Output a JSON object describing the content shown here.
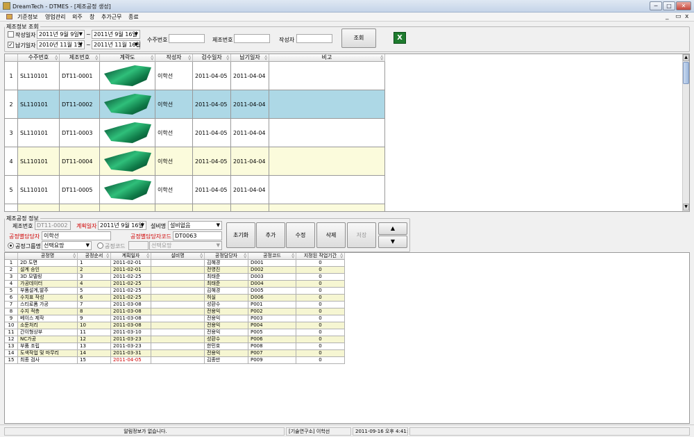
{
  "window": {
    "title": "DreamTech - DTMES - [제조공정 생성]",
    "buttons": [
      "─",
      "□",
      "✕"
    ],
    "mdi_buttons": [
      "_",
      "▭",
      "x"
    ]
  },
  "menu": [
    "기준정보",
    "영업관리",
    "외주",
    "창",
    "추가근무",
    "종료"
  ],
  "search": {
    "group_label": "제조정보 조회",
    "write_date": {
      "label": "작성일자",
      "checked": false,
      "from": "2011년  9월  9일",
      "to": "2011년  9월 16일",
      "sep": "~"
    },
    "due_date": {
      "label": "납기일자",
      "checked": true,
      "from": "2010년 11월  1일",
      "to": "2011년 11월 16일",
      "sep": "~"
    },
    "order_no": {
      "label": "수주번호",
      "value": ""
    },
    "mfg_no": {
      "label": "제조번호",
      "value": ""
    },
    "writer": {
      "label": "작성자",
      "value": ""
    },
    "search_button": "조회",
    "excel_icon": "excel-icon"
  },
  "grid1": {
    "columns": [
      "수주번호",
      "제조번호",
      "계략도",
      "작성자",
      "검수일자",
      "납기일자",
      "비고"
    ],
    "rows": [
      {
        "num": "1",
        "order": "SL110101",
        "mfg": "DT11-0001",
        "writer": "이학선",
        "check": "2011-04-05",
        "due": "2011-04-04",
        "note": ""
      },
      {
        "num": "2",
        "order": "SL110101",
        "mfg": "DT11-0002",
        "writer": "이학선",
        "check": "2011-04-05",
        "due": "2011-04-04",
        "note": ""
      },
      {
        "num": "3",
        "order": "SL110101",
        "mfg": "DT11-0003",
        "writer": "이학선",
        "check": "2011-04-05",
        "due": "2011-04-04",
        "note": ""
      },
      {
        "num": "4",
        "order": "SL110101",
        "mfg": "DT11-0004",
        "writer": "이학선",
        "check": "2011-04-05",
        "due": "2011-04-04",
        "note": ""
      },
      {
        "num": "5",
        "order": "SL110101",
        "mfg": "DT11-0005",
        "writer": "이학선",
        "check": "2011-04-05",
        "due": "2011-04-04",
        "note": ""
      }
    ]
  },
  "process_info": {
    "group_label": "제조공정 정보",
    "mfg_no": {
      "label": "제조번호",
      "value": "DT11-0002"
    },
    "plan_date": {
      "label": "계획일자",
      "value": "2011년  9월 16일"
    },
    "equipment": {
      "label": "설비명",
      "value": "설비없음"
    },
    "manager": {
      "label": "공정별담당자",
      "value": "이학선"
    },
    "manager_code": {
      "label": "공정별담당자코드",
      "value": "DT0063"
    },
    "group_name": {
      "label": "공정그룹명",
      "value": "선택요망",
      "selected": true
    },
    "process_code": {
      "label": "공정코드",
      "value": "",
      "select": "선택요망",
      "selected": false
    },
    "buttons": {
      "reset": "초기화",
      "add": "추가",
      "edit": "수정",
      "delete": "삭제",
      "save": "저장",
      "up": "▲",
      "down": "▼"
    }
  },
  "grid2": {
    "columns": [
      "공정명",
      "공정순서",
      "계획일자",
      "설비명",
      "공정담당자",
      "공정코드",
      "지정된 작업기간"
    ],
    "rows": [
      {
        "num": "1",
        "name": "2D 도면",
        "seq": "1",
        "plan": "2011-02-01",
        "equip": "",
        "mgr": "김혜경",
        "code": "D001",
        "days": "0"
      },
      {
        "num": "2",
        "name": "설계 승인",
        "seq": "2",
        "plan": "2011-02-01",
        "equip": "",
        "mgr": "전영진",
        "code": "D002",
        "days": "0"
      },
      {
        "num": "3",
        "name": "3D 모델링",
        "seq": "3",
        "plan": "2011-02-25",
        "equip": "",
        "mgr": "최태준",
        "code": "D003",
        "days": "0"
      },
      {
        "num": "4",
        "name": "가공데이터",
        "seq": "4",
        "plan": "2011-02-25",
        "equip": "",
        "mgr": "최태준",
        "code": "D004",
        "days": "0"
      },
      {
        "num": "5",
        "name": "부품설계,발주",
        "seq": "5",
        "plan": "2011-02-25",
        "equip": "",
        "mgr": "김혜경",
        "code": "D005",
        "days": "0"
      },
      {
        "num": "6",
        "name": "수치표 작성",
        "seq": "6",
        "plan": "2011-02-25",
        "equip": "",
        "mgr": "허실",
        "code": "D006",
        "days": "0"
      },
      {
        "num": "7",
        "name": "스티로폼 가공",
        "seq": "7",
        "plan": "2011-03-08",
        "equip": "",
        "mgr": "성환수",
        "code": "P001",
        "days": "0"
      },
      {
        "num": "8",
        "name": "수지 적층",
        "seq": "8",
        "plan": "2011-03-08",
        "equip": "",
        "mgr": "전용익",
        "code": "P002",
        "days": "0"
      },
      {
        "num": "9",
        "name": "베이스 제작",
        "seq": "9",
        "plan": "2011-03-08",
        "equip": "",
        "mgr": "전용익",
        "code": "P003",
        "days": "0"
      },
      {
        "num": "10",
        "name": "소둔처리",
        "seq": "10",
        "plan": "2011-03-08",
        "equip": "",
        "mgr": "전용익",
        "code": "P004",
        "days": "0"
      },
      {
        "num": "11",
        "name": "간이형상부",
        "seq": "11",
        "plan": "2011-03-10",
        "equip": "",
        "mgr": "전용익",
        "code": "P005",
        "days": "0"
      },
      {
        "num": "12",
        "name": "NC가공",
        "seq": "12",
        "plan": "2011-03-23",
        "equip": "",
        "mgr": "성환수",
        "code": "P006",
        "days": "0"
      },
      {
        "num": "13",
        "name": "부품 조립",
        "seq": "13",
        "plan": "2011-03-23",
        "equip": "",
        "mgr": "한민호",
        "code": "P008",
        "days": "0"
      },
      {
        "num": "14",
        "name": "도색작업 및 마무리",
        "seq": "14",
        "plan": "2011-03-31",
        "equip": "",
        "mgr": "전용익",
        "code": "P007",
        "days": "0"
      },
      {
        "num": "15",
        "name": "최종 검사",
        "seq": "15",
        "plan": "2011-04-05",
        "equip": "",
        "mgr": "김종만",
        "code": "P009",
        "days": "0",
        "plan_red": true
      }
    ]
  },
  "status": {
    "message": "알림정보가 없습니다.",
    "user": "[기술연구소] 이학선",
    "datetime": "2011-09-16 오후 4:41:25"
  }
}
